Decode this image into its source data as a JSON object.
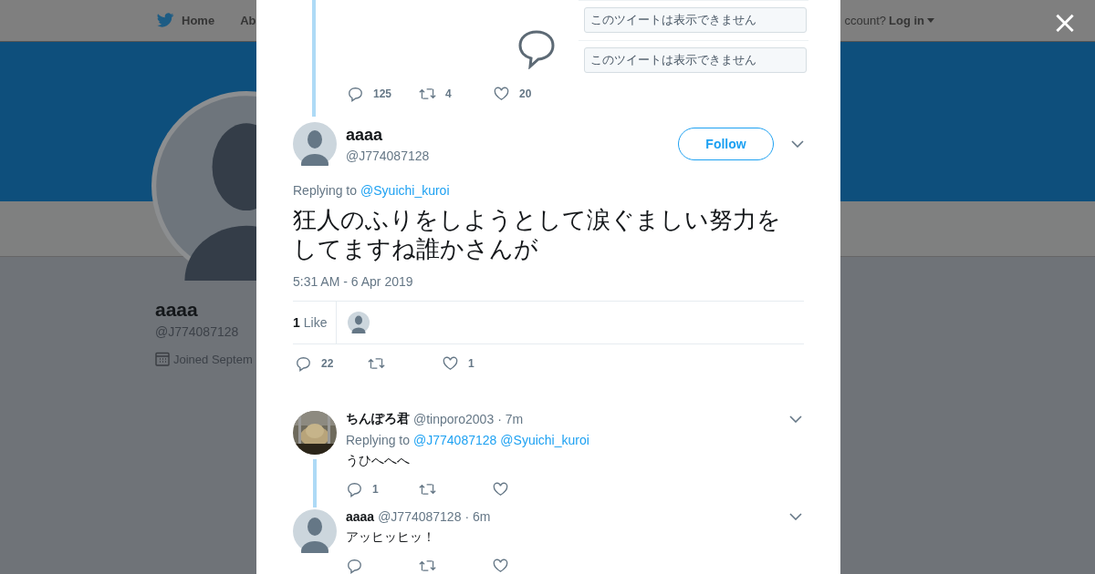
{
  "background": {
    "nav": {
      "home": "Home",
      "about": "Ab",
      "account": "ccount?",
      "login": "Log in"
    },
    "profile": {
      "name": "aaaa",
      "handle": "@J774087128",
      "joined": "Joined Septem"
    }
  },
  "close": "×",
  "previous_tweet": {
    "screenshot": {
      "rows": [
        "このツイートは表示できません",
        "このツイートは表示できません"
      ]
    },
    "actions": {
      "replies": "125",
      "retweets": "4",
      "likes": "20"
    }
  },
  "tweet": {
    "name": "aaaa",
    "handle": "@J774087128",
    "follow": "Follow",
    "replying_label": "Replying to",
    "replying_to": [
      "@Syuichi_kuroi"
    ],
    "text": "狂人のふりをしようとして涙ぐましい努力をしてますね誰かさんが",
    "date": "5:31 AM - 6 Apr 2019",
    "likes_count": "1",
    "likes_label": "Like",
    "actions": {
      "replies": "22",
      "likes": "1"
    }
  },
  "replies": [
    {
      "photo": true,
      "name": "ちんぽろ君",
      "handle": "@tinporo2003",
      "time": "· 7m",
      "replying_label": "Replying to",
      "replying_to": [
        "@J774087128",
        "@Syuichi_kuroi"
      ],
      "text": "うひへへへ",
      "thread_line": true,
      "actions": {
        "replies": "1"
      }
    },
    {
      "photo": false,
      "name": "aaaa",
      "handle": "@J774087128",
      "time": "· 6m",
      "text": "アッヒッヒッ！",
      "thread_line": false
    }
  ]
}
